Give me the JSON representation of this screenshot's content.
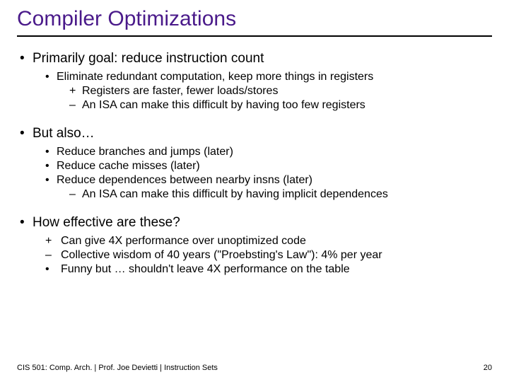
{
  "title": "Compiler Optimizations",
  "bullets": {
    "b1": "Primarily goal: reduce instruction count",
    "b1_1": "Eliminate redundant computation, keep more things in registers",
    "b1_1a": "Registers are faster, fewer loads/stores",
    "b1_1b": "An ISA can make this difficult by having too few registers",
    "b2": "But also…",
    "b2_1": "Reduce branches and jumps (later)",
    "b2_2": "Reduce cache misses (later)",
    "b2_3": "Reduce dependences between nearby insns (later)",
    "b2_3a": "An ISA can make this difficult by having implicit dependences",
    "b3": "How effective are these?",
    "b3_1": "Can give 4X performance over unoptimized code",
    "b3_2": "Collective wisdom of 40 years (\"Proebsting's Law\"): 4% per year",
    "b3_3": "Funny but … shouldn't leave 4X performance on the table"
  },
  "footer": {
    "left": "CIS 501: Comp. Arch.   |   Prof. Joe Devietti   |   Instruction Sets",
    "page": "20"
  }
}
